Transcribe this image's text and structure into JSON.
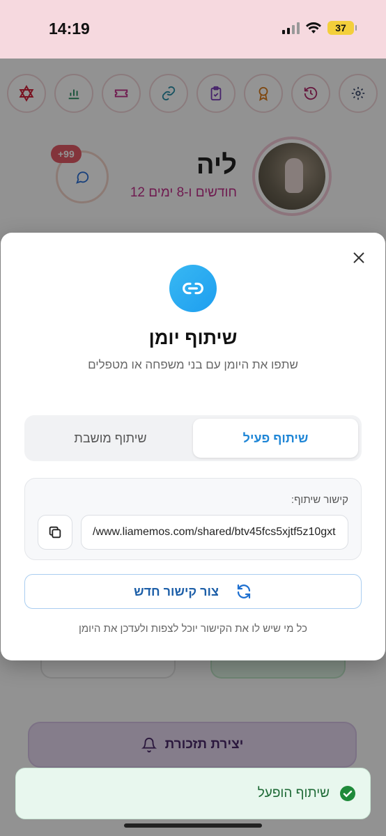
{
  "status_bar": {
    "time": "14:19",
    "battery": "37"
  },
  "background": {
    "chat_badge": "+99",
    "child_name": "ליה",
    "child_age": "12 חודשים ו-8 ימים",
    "reminder_button": "יצירת תזכורת",
    "icons": [
      "star-of-david-icon",
      "chart-icon",
      "ticket-icon",
      "link-icon",
      "clipboard-icon",
      "award-icon",
      "history-icon",
      "gear-icon"
    ]
  },
  "modal": {
    "title": "שיתוף יומן",
    "subtitle": "שתפו את היומן עם בני משפחה או מטפלים",
    "tabs": [
      {
        "label": "שיתוף פעיל",
        "active": true
      },
      {
        "label": "שיתוף מושבת",
        "active": false
      }
    ],
    "link_label": "קישור שיתוף:",
    "link_value": "/www.liamemos.com/shared/btv45fcs5xjtf5z10gxt",
    "regen_button": "צור קישור חדש",
    "note": "כל מי שיש לו את הקישור יוכל לצפות ולעדכן את היומן"
  },
  "toast": {
    "text": "שיתוף הופעל"
  },
  "colors": {
    "accent": "#1f86d6",
    "success": "#1f8a3a",
    "status_bar_bg": "#f6d9df"
  }
}
